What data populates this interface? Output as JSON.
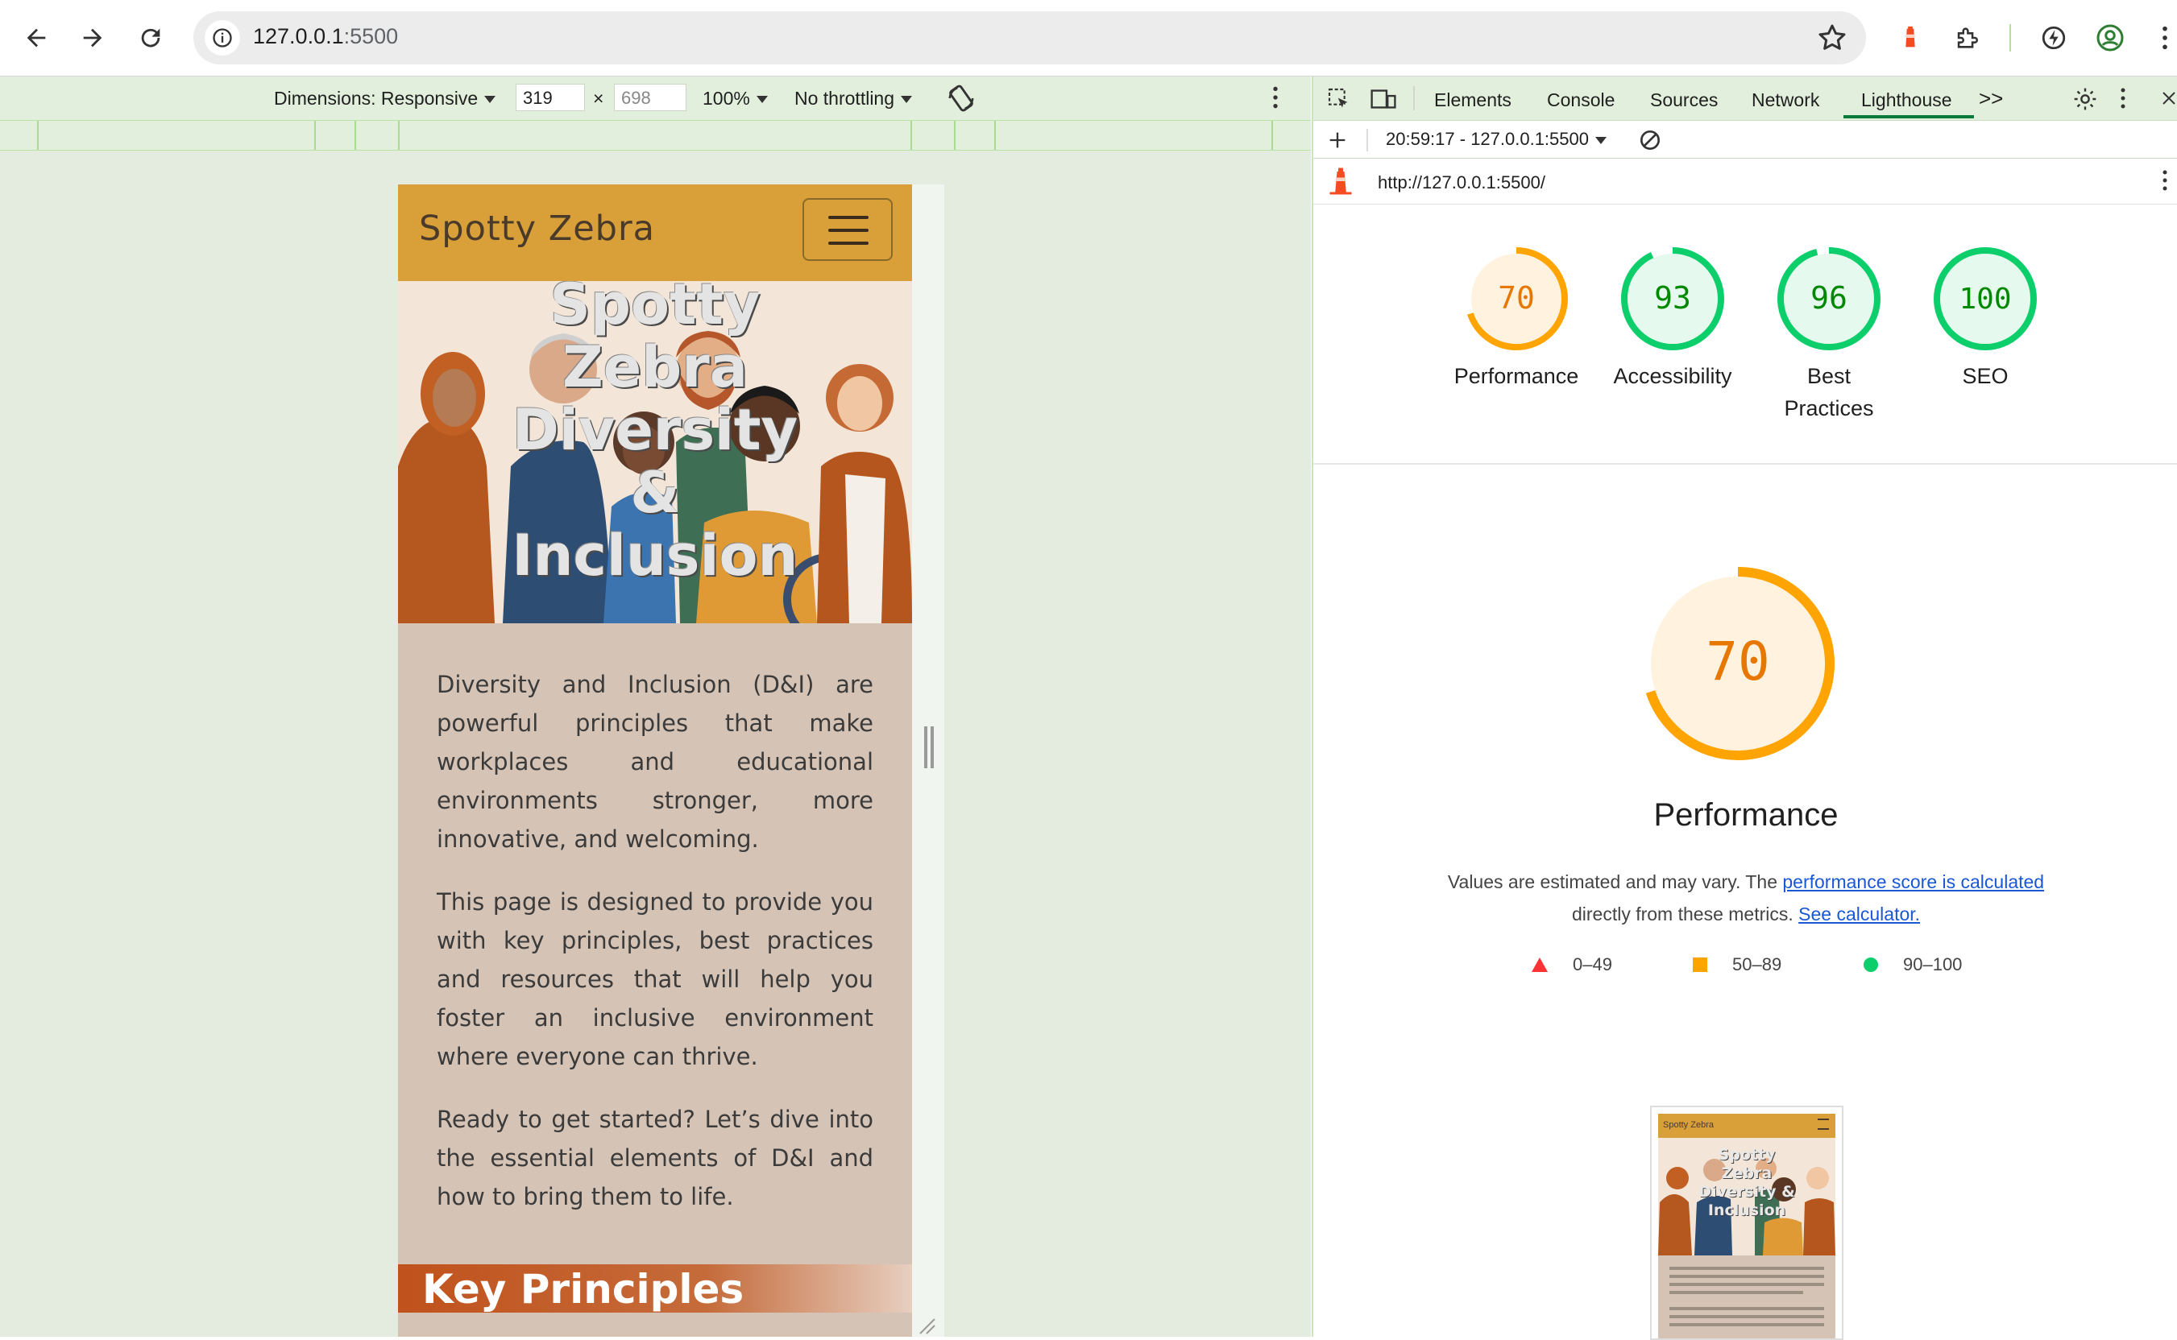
{
  "browser": {
    "url_host": "127.0.0.1",
    "url_port": ":5500"
  },
  "device_toolbar": {
    "dimensions_label": "Dimensions: Responsive",
    "width": "319",
    "x_separator": "×",
    "height": "698",
    "zoom": "100%",
    "throttling": "No throttling"
  },
  "site": {
    "brand": "Spotty Zebra",
    "hero_title": [
      "Spotty",
      "Zebra",
      "Diversity",
      "&",
      "Inclusion"
    ],
    "paragraphs": [
      "Diversity and Inclusion (D&I) are powerful principles that make workplaces and educational environments stronger, more innovative, and welcoming.",
      "This page is designed to provide you with key principles, best practices and resources that will help you foster an inclusive environment where everyone can thrive.",
      "Ready to get started? Let’s dive into the essential elements of D&I and how to bring them to life."
    ],
    "section_heading": "Key Principles"
  },
  "devtools": {
    "tabs": [
      "Elements",
      "Console",
      "Sources",
      "Network",
      "Lighthouse"
    ],
    "more_tabs": ">>",
    "active_tab": "Lighthouse",
    "report_selector": "20:59:17 - 127.0.0.1:5500",
    "report_url": "http://127.0.0.1:5500/"
  },
  "lighthouse": {
    "scores": [
      {
        "value": "70",
        "label": "Performance",
        "color": "#e67700",
        "ring": "#ffa400",
        "bg": "#fff3e0",
        "fraction": 0.7
      },
      {
        "value": "93",
        "label": "Accessibility",
        "color": "#008800",
        "ring": "#0cce6b",
        "bg": "#e6f9ee",
        "fraction": 0.93
      },
      {
        "value": "96",
        "label": "Best Practices",
        "color": "#008800",
        "ring": "#0cce6b",
        "bg": "#e6f9ee",
        "fraction": 0.96
      },
      {
        "value": "100",
        "label": "SEO",
        "color": "#008800",
        "ring": "#0cce6b",
        "bg": "#e6f9ee",
        "fraction": 1.0
      }
    ],
    "main_score": "70",
    "main_fraction": 0.7,
    "main_title": "Performance",
    "desc_prefix": "Values are estimated and may vary. The ",
    "desc_link1": "performance score is calculated",
    "desc_middle": "directly from these metrics.",
    "desc_link2": "See calculator.",
    "legend": [
      {
        "range": "0–49",
        "shape": "triangle",
        "color": "#ff3333"
      },
      {
        "range": "50–89",
        "shape": "square",
        "color": "#ffa400"
      },
      {
        "range": "90–100",
        "shape": "circle",
        "color": "#0cce6b"
      }
    ],
    "thumbnail": {
      "brand": "Spotty Zebra",
      "hero_title": [
        "Spotty",
        "Zebra",
        "Diversity &",
        "Inclusion"
      ]
    }
  }
}
